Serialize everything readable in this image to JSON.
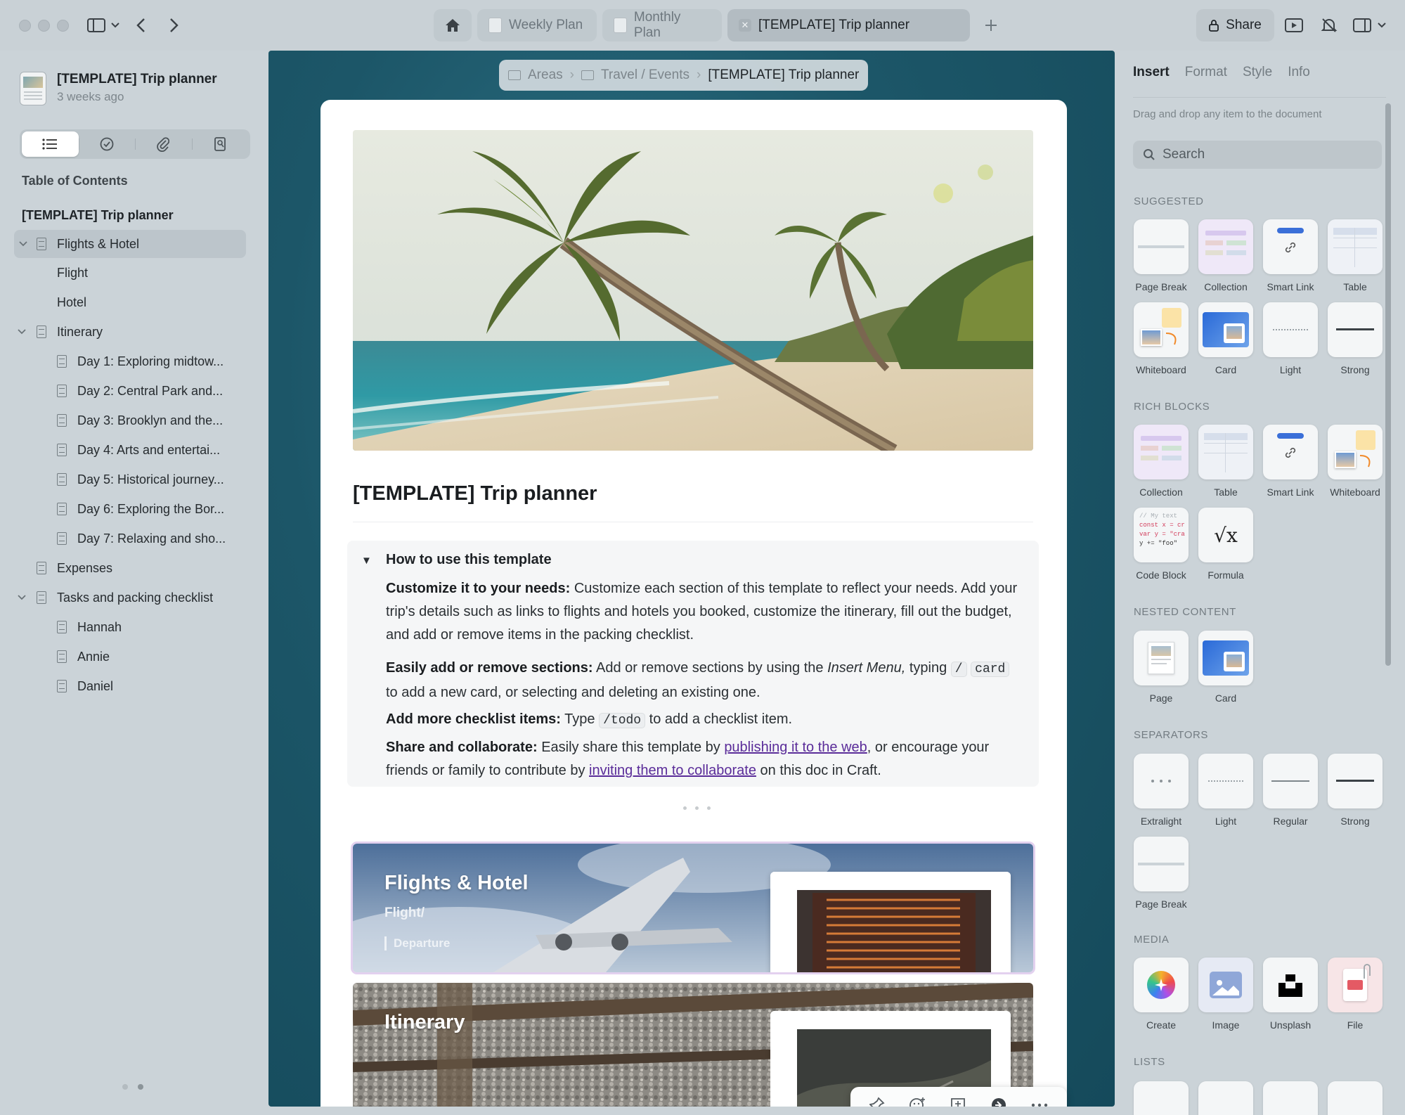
{
  "window": {
    "tabs": [
      {
        "label": "Weekly Plan"
      },
      {
        "label": "Monthly Plan"
      },
      {
        "label": "[TEMPLATE] Trip planner"
      }
    ],
    "share_label": "Share"
  },
  "sidebar": {
    "doc_title": "[TEMPLATE] Trip planner",
    "doc_updated": "3 weeks ago",
    "toc_heading": "Table of Contents",
    "toc_root": "[TEMPLATE] Trip planner",
    "items": [
      {
        "label": "Flights & Hotel"
      },
      {
        "label": "Flight"
      },
      {
        "label": "Hotel"
      },
      {
        "label": "Itinerary"
      },
      {
        "label": "Day 1: Exploring midtow..."
      },
      {
        "label": "Day 2: Central Park and..."
      },
      {
        "label": "Day 3: Brooklyn and the..."
      },
      {
        "label": "Day 4: Arts and entertai..."
      },
      {
        "label": "Day 5: Historical journey..."
      },
      {
        "label": "Day 6: Exploring the Bor..."
      },
      {
        "label": "Day 7: Relaxing and sho..."
      },
      {
        "label": "Expenses"
      },
      {
        "label": "Tasks and packing checklist"
      },
      {
        "label": "Hannah"
      },
      {
        "label": "Annie"
      },
      {
        "label": "Daniel"
      }
    ]
  },
  "breadcrumb": {
    "items": [
      "Areas",
      "Travel / Events"
    ],
    "current": "[TEMPLATE] Trip planner"
  },
  "document": {
    "title": "[TEMPLATE] Trip planner",
    "howto": {
      "heading": "How to use this template",
      "p1_bold": "Customize it to your needs:",
      "p1_text": "Customize each section of this template to reflect your needs. Add your trip's details such as links to flights and hotels you booked, customize the itinerary, fill out the budget, and add or remove items in the packing checklist.",
      "p2_bold": "Easily add or remove sections:",
      "p2_text_a": "Add or remove sections by using the",
      "p2_italic": "Insert Menu,",
      "p2_text_b": "typing",
      "p2_code1": "/",
      "p2_code2": "card",
      "p2_text_c": "to add a new card, or selecting and deleting an existing one.",
      "p3_bold": "Add more checklist items:",
      "p3_text_a": "Type",
      "p3_code": "/todo",
      "p3_text_b": "to add a checklist item.",
      "p4_bold": "Share and collaborate:",
      "p4_text_a": "Easily share this template by",
      "p4_link1": "publishing it to the web",
      "p4_text_b": ", or encourage your friends or family to contribute by",
      "p4_link2": "inviting them to collaborate",
      "p4_text_c": "on this doc in Craft."
    },
    "cards": [
      {
        "title": "Flights & Hotel",
        "subtitle": "Flight/",
        "detail": "Departure"
      },
      {
        "title": "Itinerary"
      }
    ]
  },
  "rpanel": {
    "tabs": [
      "Insert",
      "Format",
      "Style",
      "Info"
    ],
    "hint": "Drag and drop any item to the document",
    "search_placeholder": "Search",
    "sections": {
      "suggested": "SUGGESTED",
      "rich": "RICH BLOCKS",
      "nested": "NESTED CONTENT",
      "separators": "SEPARATORS",
      "media": "MEDIA",
      "lists": "LISTS"
    },
    "suggested": [
      "Page Break",
      "Collection",
      "Smart Link",
      "Table",
      "Whiteboard",
      "Card",
      "Light",
      "Strong"
    ],
    "rich": [
      "Collection",
      "Table",
      "Smart Link",
      "Whiteboard",
      "Code Block",
      "Formula"
    ],
    "code_sample": [
      "// My text",
      "const x = cr",
      "var y = \"cra",
      "y += \"foo\""
    ],
    "nested": [
      "Page",
      "Card"
    ],
    "separators": [
      "Extralight",
      "Light",
      "Regular",
      "Strong",
      "Page Break"
    ],
    "media": [
      "Create",
      "Image",
      "Unsplash",
      "File"
    ]
  },
  "colors": {
    "accent_link": "#5a2c99",
    "canvas_bg": "#1c5668",
    "sidebar_bg": "#cbd3d8"
  }
}
